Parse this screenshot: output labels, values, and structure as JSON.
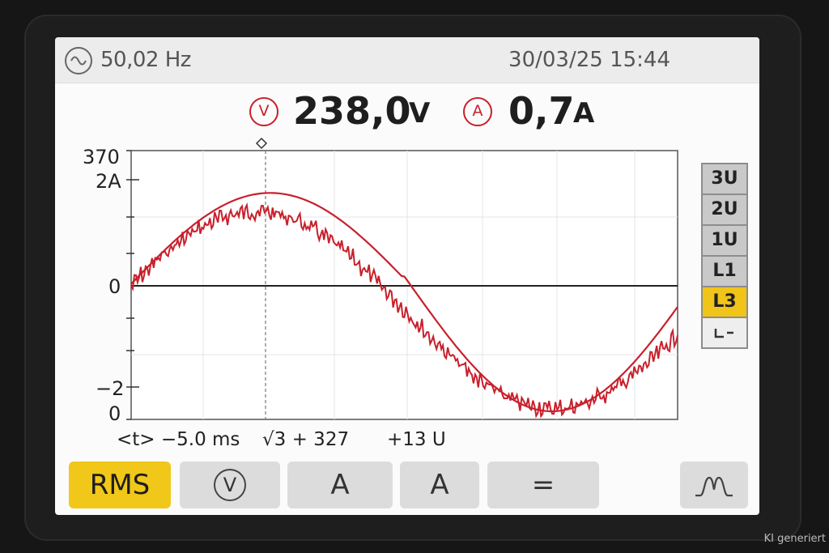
{
  "status_bar": {
    "frequency": "50,02 Hz",
    "datetime": "30/03/25 15:44"
  },
  "readings": {
    "voltage_icon": "V",
    "voltage_value": "238,0",
    "voltage_unit": "V",
    "current_icon": "A",
    "current_value": "0,7",
    "current_unit": "A"
  },
  "plot": {
    "y_labels": [
      "370",
      "2A",
      "0",
      "−2",
      "0"
    ]
  },
  "cursor_row": {
    "time": "<t> −5.0 ms",
    "value": "√3 + 327",
    "offset": "+13 U"
  },
  "channels": [
    "3U",
    "2U",
    "1U",
    "L1",
    "L3",
    "⌙⌐"
  ],
  "active_channel": "L3",
  "softkeys": {
    "rms": "RMS",
    "volt": "V",
    "amp1": "A",
    "amp2": "A",
    "equals": "=",
    "harmonics_icon": "waveform-icon"
  },
  "colors": {
    "trace": "#c8202c",
    "accent_yellow": "#f1c71a"
  },
  "watermark": "KI generiert"
}
